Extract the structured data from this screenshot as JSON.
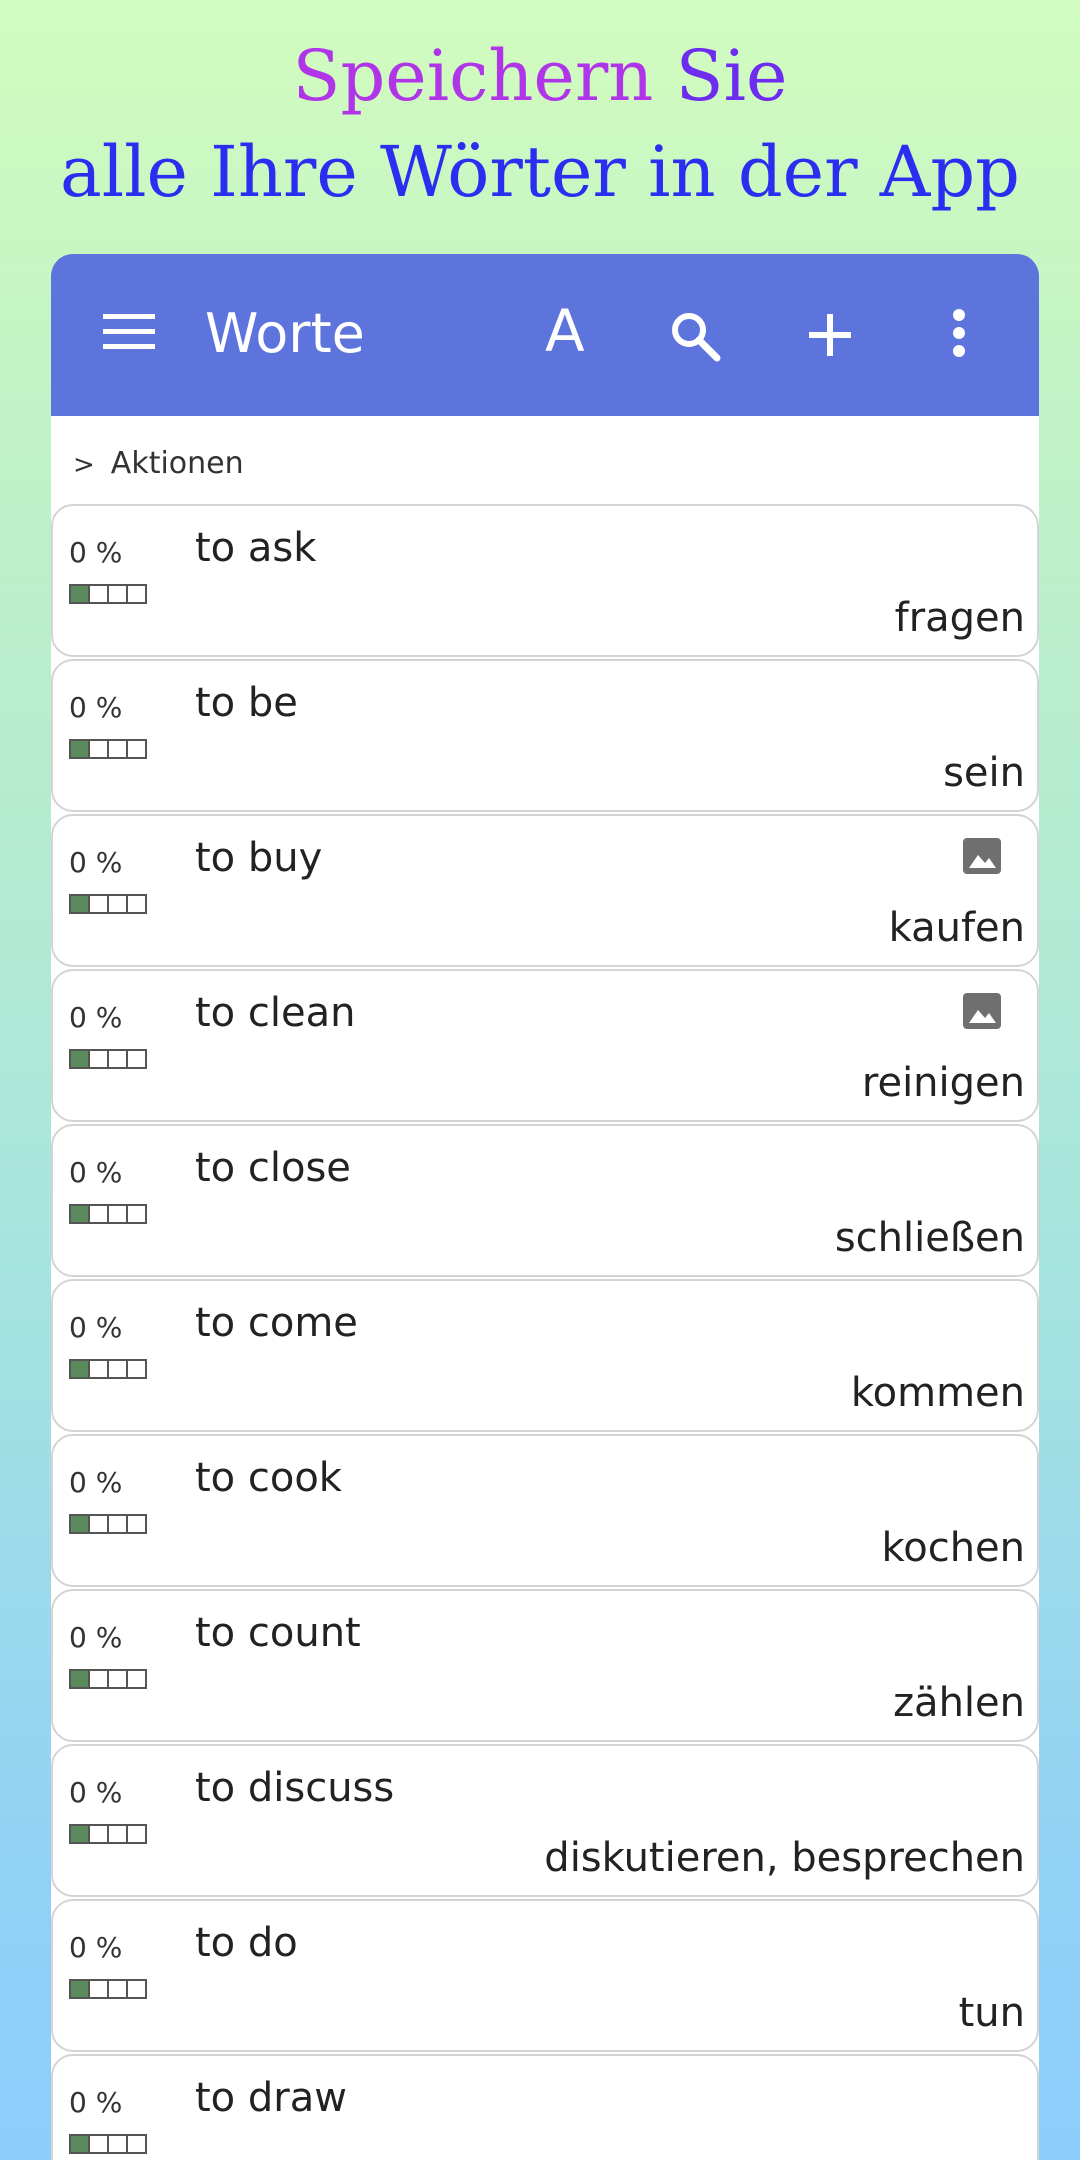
{
  "promo": {
    "line1_word1": "Speichern",
    "line1_word2": "Sie",
    "line2": "alle Ihre Wörter in der App"
  },
  "appbar": {
    "title": "Worte",
    "sort_label": "A",
    "icons": [
      "menu-icon",
      "sort-icon",
      "search-icon",
      "add-icon",
      "more-vert-icon"
    ],
    "color": "#5c74dc"
  },
  "actions": {
    "chevron": ">",
    "label": "Aktionen"
  },
  "words": [
    {
      "pct": "0 %",
      "word": "to ask",
      "translation": "fragen",
      "has_image": false
    },
    {
      "pct": "0 %",
      "word": "to be",
      "translation": "sein",
      "has_image": false
    },
    {
      "pct": "0 %",
      "word": "to buy",
      "translation": "kaufen",
      "has_image": true
    },
    {
      "pct": "0 %",
      "word": "to clean",
      "translation": "reinigen",
      "has_image": true
    },
    {
      "pct": "0 %",
      "word": "to close",
      "translation": "schließen",
      "has_image": false
    },
    {
      "pct": "0 %",
      "word": "to come",
      "translation": "kommen",
      "has_image": false
    },
    {
      "pct": "0 %",
      "word": "to cook",
      "translation": "kochen",
      "has_image": false
    },
    {
      "pct": "0 %",
      "word": "to count",
      "translation": "zählen",
      "has_image": false
    },
    {
      "pct": "0 %",
      "word": "to discuss",
      "translation": "diskutieren, besprechen",
      "has_image": false
    },
    {
      "pct": "0 %",
      "word": "to do",
      "translation": "tun",
      "has_image": false
    },
    {
      "pct": "0 %",
      "word": "to draw",
      "translation": "",
      "has_image": false
    }
  ],
  "progress": {
    "filled": 1,
    "total": 4,
    "fill_color": "#5b8a5c"
  }
}
